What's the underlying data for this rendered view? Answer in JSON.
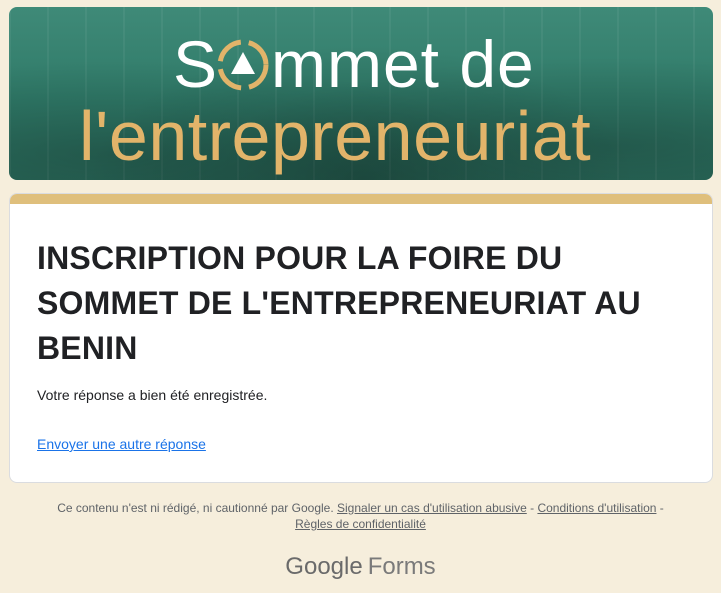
{
  "banner": {
    "line1_a": "S",
    "line1_b": "mmet de",
    "line2": "l'entrepreneuriat",
    "colors": {
      "teal": "#347f6d",
      "white_text": "#ffffff",
      "gold_text": "#e2b46a"
    },
    "icon": "triangle-circle-arrows-icon"
  },
  "card": {
    "accent_color": "#dfbf7c",
    "title": "INSCRIPTION POUR LA FOIRE DU SOMMET DE L'ENTREPRENEURIAT AU BENIN",
    "message": "Votre réponse a bien été enregistrée.",
    "link": "Envoyer une autre réponse"
  },
  "footer": {
    "disclaimer": "Ce contenu n'est ni rédigé, ni cautionné par Google.",
    "report_abuse": "Signaler un cas d'utilisation abusive",
    "sep1": " - ",
    "terms": "Conditions d'utilisation",
    "sep2": " - ",
    "privacy": "Règles de confidentialité"
  },
  "brand": {
    "google": "Google",
    "forms": "Forms"
  }
}
